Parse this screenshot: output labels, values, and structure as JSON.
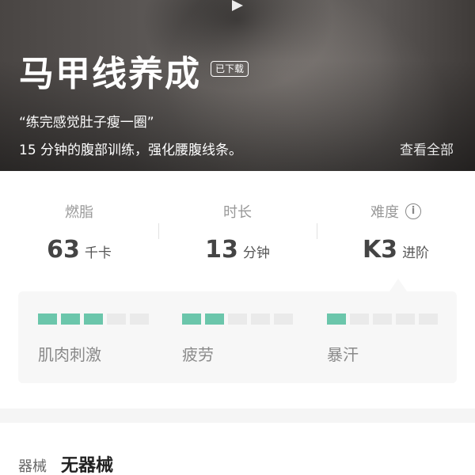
{
  "hero": {
    "title": "马甲线养成",
    "badge": "已下载",
    "quote": "“练完感觉肚子瘦一圈”",
    "description": "15 分钟的腹部训练，强化腰腹线条。",
    "view_all": "查看全部"
  },
  "stats": [
    {
      "label": "燃脂",
      "value": "63",
      "unit": "千卡"
    },
    {
      "label": "时长",
      "value": "13",
      "unit": "分钟"
    },
    {
      "label": "难度",
      "value": "K3",
      "unit": "进阶",
      "info_icon": "info-icon"
    }
  ],
  "intensity": [
    {
      "label": "肌肉刺激",
      "level": 3,
      "max": 5
    },
    {
      "label": "疲劳",
      "level": 2,
      "max": 5
    },
    {
      "label": "暴汗",
      "level": 1,
      "max": 5
    }
  ],
  "equipment": {
    "label": "器械",
    "value": "无器械"
  },
  "colors": {
    "accent": "#6bc6ab",
    "bar_off": "#eaeaea",
    "card_bg": "#f7f7f7"
  }
}
